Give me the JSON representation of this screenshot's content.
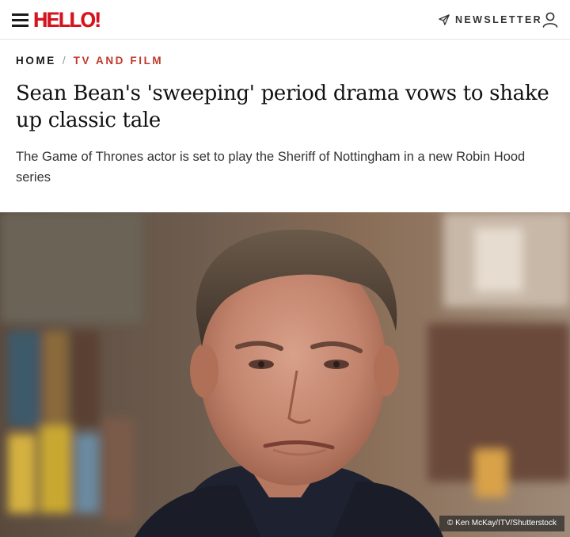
{
  "header": {
    "logo_text": "HELLO!",
    "newsletter_label": "NEWSLETTER",
    "icons": [
      "menu-icon",
      "paper-plane-icon",
      "user-icon"
    ],
    "brand_color": "#d4141e"
  },
  "breadcrumb": {
    "home": "HOME",
    "separator": "/",
    "section": "TV AND FILM",
    "section_color": "#c0392b"
  },
  "article": {
    "headline": "Sean Bean's 'sweeping' period drama vows to shake up classic tale",
    "standfirst": "The Game of Thrones actor is set to play the Sheriff of Nottingham in a new Robin Hood series",
    "image_credit": "© Ken McKay/ITV/Shutterstock"
  }
}
